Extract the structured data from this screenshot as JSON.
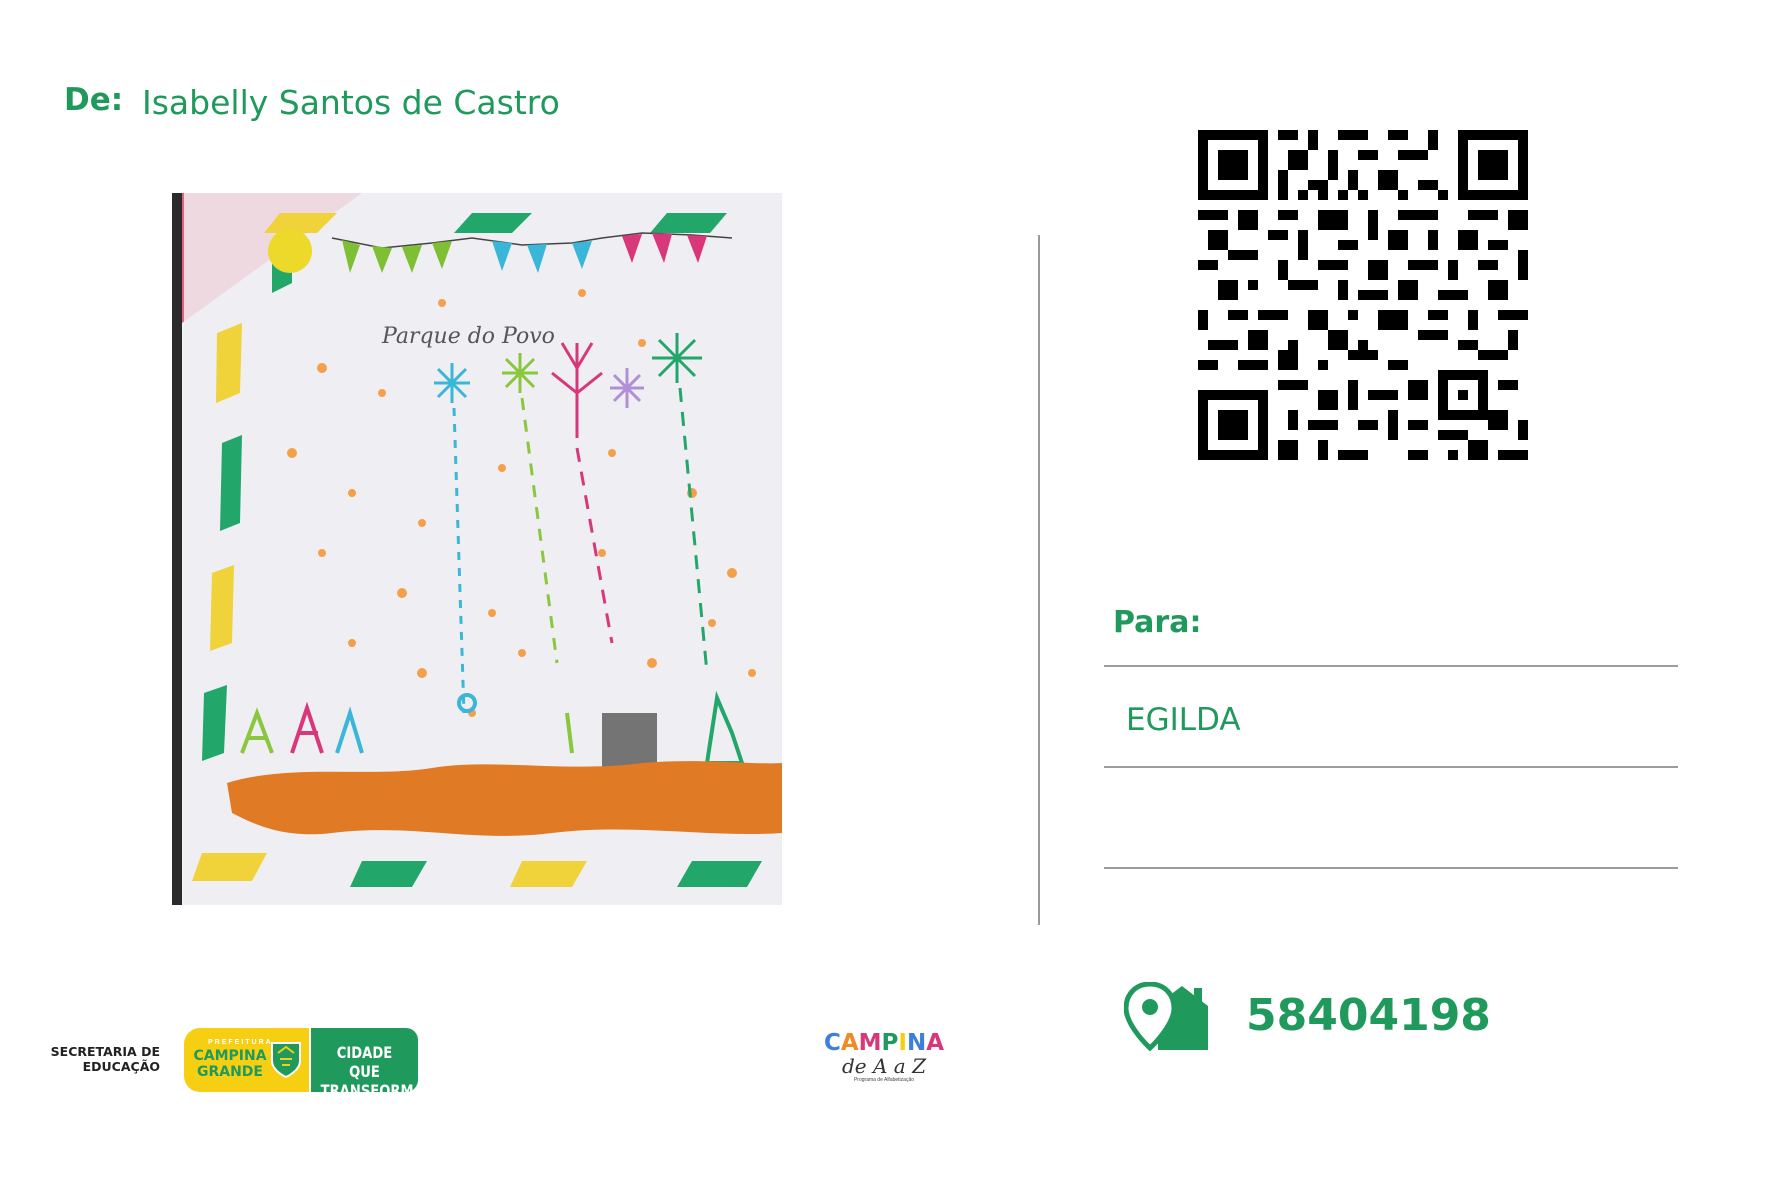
{
  "from": {
    "label": "De:",
    "name": "Isabelly Santos de Castro"
  },
  "drawing": {
    "caption_handwritten": "Parque do Povo"
  },
  "qr_code": {
    "icon": "qr-code"
  },
  "to": {
    "label": "Para:",
    "name": "EGILDA",
    "line2": ""
  },
  "postal": {
    "icon": "house-location-icon",
    "cep": "58404198"
  },
  "logos": {
    "secretaria": "SECRETARIA DE EDUCAÇÃO",
    "prefeitura_small": "PREFEITURA",
    "prefeitura_big": "CAMPINA GRANDE",
    "cidade": "CIDADE QUE TRANSFORMA",
    "campina_title": "CAMPINA",
    "campina_sub": "de A a Z",
    "campina_tiny": "Programa de Alfabetização"
  },
  "colors": {
    "brand_green": "#1f9a5c",
    "brand_yellow": "#f6cf13"
  }
}
